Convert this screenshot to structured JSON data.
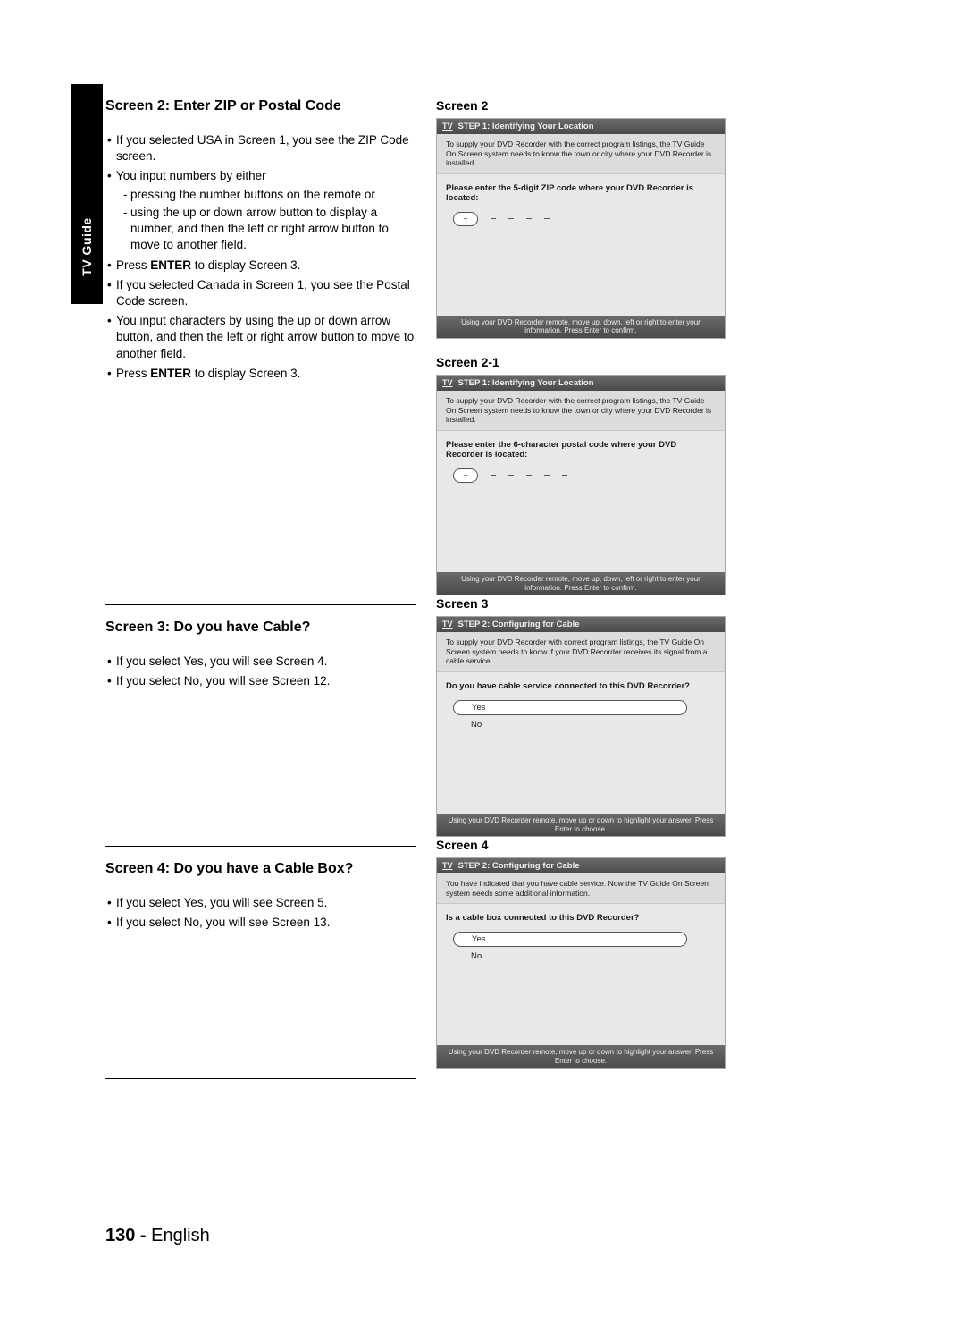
{
  "sideTab": "TV Guide",
  "pageNumber": "130 -",
  "pageLang": "English",
  "sections": {
    "s2": {
      "title": "Screen 2: Enter ZIP or Postal Code",
      "b1": "If you selected USA in Screen 1, you see the ZIP Code screen.",
      "b2": "You input numbers by either",
      "b2a": "pressing the number buttons on the remote or",
      "b2b": "using the up or down arrow button to display a number, and then the left or right arrow button to move to another field.",
      "b3a": "Press ",
      "b3b": "ENTER",
      "b3c": " to display Screen 3.",
      "b4": "If you selected Canada in Screen 1, you see the Postal Code screen.",
      "b5": "You input characters by using the up or down arrow button, and then the left or right arrow button to move to another field.",
      "b6a": "Press ",
      "b6b": "ENTER",
      "b6c": " to display Screen 3."
    },
    "s3": {
      "title": "Screen 3: Do you have Cable?",
      "b1": "If you select Yes, you will see Screen 4.",
      "b2": "If you select No, you will see Screen 12."
    },
    "s4": {
      "title": "Screen 4: Do you have a Cable Box?",
      "b1": "If you select Yes, you will see Screen 5.",
      "b2": "If you select No, you will see Screen 13."
    }
  },
  "screens": {
    "sc2": {
      "label": "Screen 2",
      "header": "STEP 1: Identifying Your Location",
      "intro": "To supply your DVD Recorder with the correct program listings, the TV Guide On Screen system needs to know the town or city where your DVD Recorder is installed.",
      "prompt": "Please enter the 5-digit ZIP code where your DVD Recorder is located:",
      "footer": "Using your DVD Recorder remote, move up, down, left or right to enter your information.  Press Enter to confirm."
    },
    "sc21": {
      "label": "Screen 2-1",
      "header": "STEP 1: Identifying Your Location",
      "intro": "To supply your DVD Recorder with the correct program listings, the TV Guide On Screen system needs to know the town or city where your DVD Recorder is installed.",
      "prompt": "Please enter the 6-character postal code where your DVD Recorder is located:",
      "footer": "Using your DVD Recorder remote, move up, down, left or right to enter your information.  Press Enter to confirm."
    },
    "sc3": {
      "label": "Screen 3",
      "header": "STEP 2: Configuring for Cable",
      "intro": "To supply your DVD Recorder with correct program listings, the TV Guide On Screen system needs to know if your DVD Recorder receives its signal from a cable service.",
      "prompt": "Do you have cable service connected to this DVD Recorder?",
      "opt1": "Yes",
      "opt2": "No",
      "footer": "Using your DVD Recorder remote, move up or down to highlight your answer.  Press Enter to choose."
    },
    "sc4": {
      "label": "Screen 4",
      "header": "STEP 2: Configuring for Cable",
      "intro": "You have indicated that you have cable service. Now the TV Guide On Screen system needs some additional information.",
      "prompt": "Is a cable box connected to this DVD Recorder?",
      "opt1": "Yes",
      "opt2": "No",
      "footer": "Using your DVD Recorder remote, move up or down to highlight your answer.  Press Enter to choose."
    },
    "tvLogo": "TV"
  }
}
